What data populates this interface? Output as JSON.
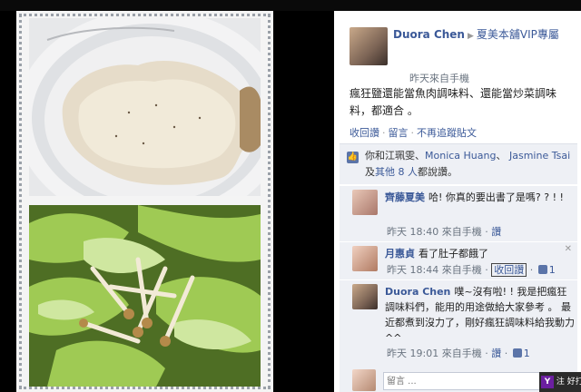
{
  "topbar": {
    "ghost_text": ""
  },
  "post": {
    "author": "Duora Chen",
    "group": "夏美本舖VIP專屬",
    "time": "昨天來自手機",
    "body": "瘋狂鹽還能當魚肉調味料、還能當炒菜調味料，都適合 。",
    "actions": {
      "comment": "收回讚",
      "sep": "·",
      "reply": "留言",
      "unfollow": "不再追蹤貼文"
    }
  },
  "likes": {
    "prefix": "你和江珮雯、",
    "name1": "Monica Huang",
    "sep": "、",
    "name2": "Jasmine Tsai",
    "and": "及",
    "others": "其他 8 人",
    "suffix": "都說讚。"
  },
  "comments": [
    {
      "name": "齊藤夏美",
      "text": "哈! 你真的要出書了是嗎? ? ! !",
      "time": "昨天 18:40",
      "via": "來自手機",
      "like": "讚"
    },
    {
      "name": "月惠貞",
      "text": "看了肚子都餓了",
      "time": "昨天 18:44",
      "via": "來自手機",
      "like": "收回讚",
      "count": "1"
    },
    {
      "name": "Duora Chen",
      "text": "噗~沒有啦! ! 我是把瘋狂調味料們，能用的用途做給大家參考 。 最近都煮到沒力了，剛好瘋狂調味料給我動力^^",
      "time": "昨天 19:01",
      "via": "來自手機",
      "like": "讚",
      "count": "1"
    }
  ],
  "reply": {
    "placeholder": "留言 ..."
  },
  "yahoo": {
    "label": "注 好打"
  }
}
